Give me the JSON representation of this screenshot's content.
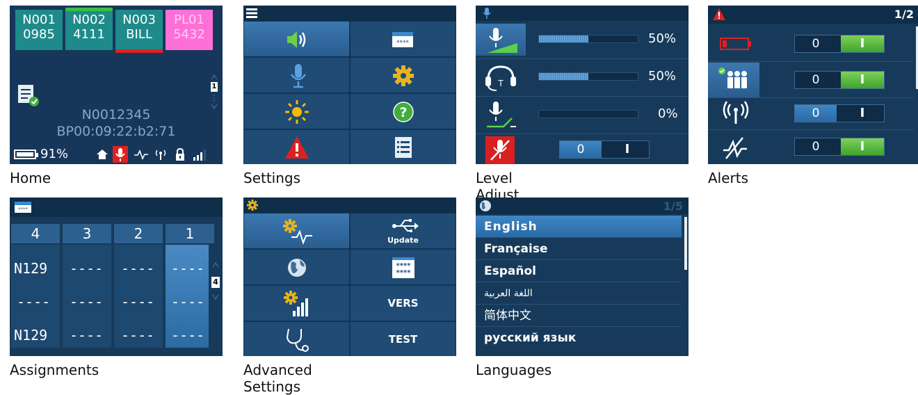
{
  "home": {
    "caption": "Home",
    "tiles": [
      {
        "line1": "N001",
        "line2": "0985"
      },
      {
        "line1": "N002",
        "line2": "4111"
      },
      {
        "line1": "N003",
        "line2": "BILL"
      },
      {
        "line1": "PL01",
        "line2": "5432"
      }
    ],
    "page_indicator": "1",
    "device_id": "N0012345",
    "bt_address": "BP00:09:22:b2:71",
    "battery_percent": "91%",
    "battery_level": 0.91,
    "colors": {
      "tile": "#1f8a8a",
      "tile_pink": "#ff6fd8",
      "green_bar": "#38c040",
      "red_bar": "#e02020",
      "mic_red": "#e02020"
    }
  },
  "settings": {
    "caption": "Settings",
    "items": [
      "speaker-icon",
      "assignments-icon",
      "microphone-icon",
      "gear-icon",
      "brightness-icon",
      "help-icon",
      "warning-icon",
      "list-icon"
    ]
  },
  "level_adjust": {
    "caption": "Level Adjust",
    "rows": [
      {
        "icon": "mic-level-icon",
        "value": "50%",
        "level": 0.5
      },
      {
        "icon": "headset-icon",
        "value": "50%",
        "level": 0.5
      },
      {
        "icon": "mic-sidetone-icon",
        "value": "0%",
        "level": 0
      }
    ],
    "mute_toggle": {
      "value": "0",
      "switch": "I"
    }
  },
  "alerts": {
    "caption": "Alerts",
    "page": "1/2",
    "rows": [
      {
        "icon": "battery-low-icon",
        "value": "0",
        "switch": "I",
        "state": "on"
      },
      {
        "icon": "group-icon",
        "value": "0",
        "switch": "I",
        "state": "on"
      },
      {
        "icon": "wireless-icon",
        "value": "0",
        "switch": "I",
        "state": "off"
      },
      {
        "icon": "signal-loss-icon",
        "value": "0",
        "switch": "I",
        "state": "on"
      }
    ]
  },
  "assignments": {
    "caption": "Assignments",
    "headers": [
      "4",
      "3",
      "2",
      "1"
    ],
    "rows": [
      [
        "N129",
        "----",
        "----",
        "----"
      ],
      [
        "----",
        "----",
        "----",
        "----"
      ],
      [
        "N129",
        "----",
        "----",
        "----"
      ]
    ],
    "page_indicator": "4"
  },
  "advanced_settings": {
    "caption": "Advanced Settings",
    "update_label": "Update",
    "vers_label": "VERS",
    "test_label": "TEST",
    "stars_top": "****",
    "stars_bottom": "****"
  },
  "languages": {
    "caption": "Languages",
    "page": "1/5",
    "items": [
      "English",
      "Française",
      "Español",
      "اللغة العربية",
      "简体中文",
      "русский язык"
    ]
  }
}
